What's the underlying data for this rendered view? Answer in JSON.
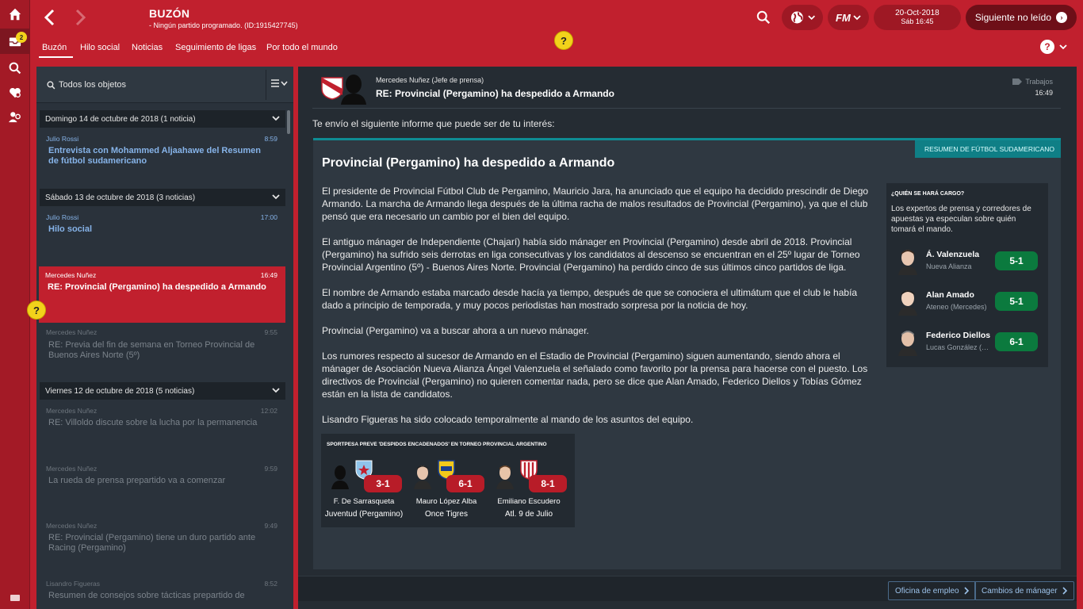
{
  "app": {
    "title": "BUZÓN",
    "subtitle": "- Ningún partido programado. (ID:1915427745)",
    "date": "20-Oct-2018",
    "time": "Sáb 16:45",
    "next_unread": "Siguiente no leído",
    "fm_logo": "FM",
    "rail_badge": "2",
    "colors": {
      "accent": "#c1202e",
      "selected": "#c1202e",
      "odds_green": "#0b7a3e",
      "odds_red": "#b81c28",
      "link": "#86b3e8"
    }
  },
  "tabs": [
    {
      "label": "Buzón"
    },
    {
      "label": "Hilo social"
    },
    {
      "label": "Noticias"
    },
    {
      "label": "Seguimiento de ligas"
    },
    {
      "label": "Por todo el mundo"
    }
  ],
  "help_glyph": "?",
  "inbox": {
    "filter": "Todos los objetos",
    "groups": [
      {
        "label": "Domingo 14 de octubre de 2018 (1 noticia)",
        "items": [
          {
            "from": "Julio Rossi",
            "time": "8:59",
            "subject": "Entrevista con Mohammed Aljaahawe del Resumen de fútbol sudamericano"
          }
        ]
      },
      {
        "label": "Sábado 13 de octubre de 2018 (3 noticias)",
        "items": [
          {
            "from": "Julio Rossi",
            "time": "17:00",
            "subject": "Hilo social"
          },
          {
            "from": "Mercedes Nuñez",
            "time": "16:49",
            "subject": "RE: Provincial (Pergamino) ha despedido a Armando"
          },
          {
            "from": "Mercedes Nuñez",
            "time": "9:55",
            "subject": "RE: Previa del fin de semana en Torneo Provincial de Buenos Aires Norte (5º)"
          }
        ]
      },
      {
        "label": "Viernes 12 de octubre de 2018 (5 noticias)",
        "items": [
          {
            "from": "Mercedes Nuñez",
            "time": "12:02",
            "subject": "RE: Villoldo discute sobre la lucha por la permanencia"
          },
          {
            "from": "Mercedes Nuñez",
            "time": "9:59",
            "subject": "La rueda de prensa prepartido va a comenzar"
          },
          {
            "from": "Mercedes Nuñez",
            "time": "9:49",
            "subject": "RE: Provincial (Pergamino) tiene un duro partido ante Racing (Pergamino)"
          },
          {
            "from": "Lisandro Figueras",
            "time": "8:52",
            "subject": "Resumen de consejos sobre tácticas prepartido de"
          }
        ]
      }
    ]
  },
  "message": {
    "sender": "Mercedes Nuñez  (Jefe de prensa)",
    "subject": "RE: Provincial (Pergamino) ha despedido a Armando",
    "tag": "Trabajos",
    "time": "16:49",
    "intro": "Te envío el siguiente informe que puede ser de tu interés:",
    "source": "RESUMEN DE FÚTBOL SUDAMERICANO",
    "headline": "Provincial (Pergamino) ha despedido a Armando",
    "paragraphs": [
      "El presidente de Provincial Fútbol Club de Pergamino, Mauricio Jara, ha anunciado que el equipo ha decidido prescindir de Diego Armando. La marcha de Armando llega después de la última racha de malos resultados de Provincial (Pergamino), ya que el club pensó que era necesario un cambio por el bien del equipo.",
      "El antiguo mánager de Independiente (Chajarí) había sido mánager en Provincial (Pergamino) desde abril de 2018. Provincial (Pergamino) ha sufrido seis derrotas en liga consecutivas y los candidatos al descenso se encuentran en el 25º lugar de Torneo Provincial Argentino (5º) - Buenos Aires Norte. Provincial (Pergamino) ha perdido cinco de sus últimos cinco partidos de liga.",
      "El nombre de Armando estaba marcado desde hacía ya tiempo, después de que se conociera el ultimátum que el club le había dado a principio de temporada, y muy pocos periodistas han mostrado sorpresa por la noticia de hoy.",
      "Provincial (Pergamino) va a buscar ahora a un nuevo mánager.",
      "Los rumores respecto al sucesor de Armando en el Estadio de Provincial (Pergamino) siguen aumentando, siendo ahora el mánager de Asociación Nueva Alianza Ángel Valenzuela el señalado como favorito por la prensa para hacerse con el puesto. Los directivos de Provincial (Pergamino) no quieren comentar nada, pero se dice que Alan Amado, Federico Diellos y Tobías Gómez están en la lista de candidatos.",
      "Lisandro Figueras ha sido colocado temporalmente al mando de los asuntos del equipo."
    ],
    "who_box": {
      "heading": "¿QUIÉN SE HARÁ CARGO?",
      "text": "Los expertos de prensa y corredores de apuestas ya especulan sobre quién tomará el mando.",
      "candidates": [
        {
          "name": "Á. Valenzuela",
          "club": "Nueva Alianza",
          "odds": "5-1"
        },
        {
          "name": "Alan Amado",
          "club": "Ateneo (Mercedes)",
          "odds": "5-1"
        },
        {
          "name": "Federico Diellos",
          "club": "Lucas González (Entre Ríos)",
          "odds": "6-1"
        }
      ]
    },
    "sport_box": {
      "heading": "SPORTPESA PREVÉ 'DESPIDOS ENCADENADOS' EN TORNEO PROVINCIAL ARGENTINO",
      "predictions": [
        {
          "name": "F. De Sarrasqueta",
          "club": "Juventud (Pergamino)",
          "odds": "3-1"
        },
        {
          "name": "Mauro López Alba",
          "club": "Once Tigres",
          "odds": "6-1"
        },
        {
          "name": "Emiliano Escudero",
          "club": "Atl. 9 de Julio",
          "odds": "8-1"
        }
      ]
    }
  },
  "footer": {
    "btn1": "Oficina de empleo",
    "btn2": "Cambios de mánager"
  }
}
